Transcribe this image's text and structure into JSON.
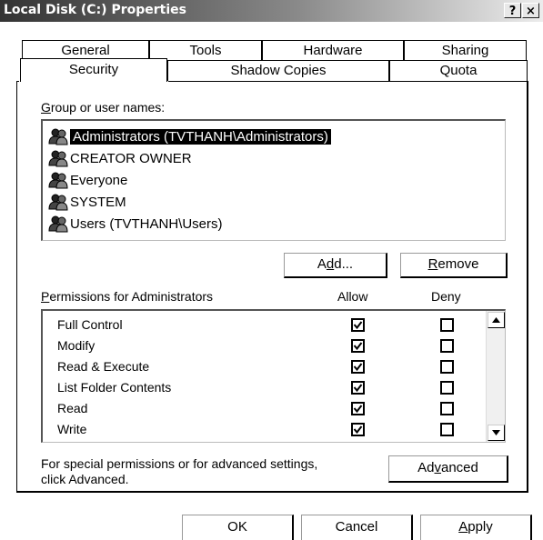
{
  "window": {
    "title": "Local Disk (C:) Properties",
    "help_button": "?",
    "close_button": "×"
  },
  "tabs": {
    "row_back": [
      "General",
      "Tools",
      "Hardware",
      "Sharing"
    ],
    "row_front": [
      "Security",
      "Shadow Copies",
      "Quota"
    ],
    "active": "Security"
  },
  "security": {
    "group_label": "Group or user names:",
    "users": [
      {
        "name": "Administrators (TVTHANH\\Administrators)",
        "selected": true
      },
      {
        "name": "CREATOR OWNER",
        "selected": false
      },
      {
        "name": "Everyone",
        "selected": false
      },
      {
        "name": "SYSTEM",
        "selected": false
      },
      {
        "name": "Users (TVTHANH\\Users)",
        "selected": false
      }
    ],
    "add_button": "Add...",
    "remove_button": "Remove",
    "permissions_label": "Permissions for Administrators",
    "allow_header": "Allow",
    "deny_header": "Deny",
    "permissions": [
      {
        "name": "Full Control",
        "allow": true,
        "deny": false
      },
      {
        "name": "Modify",
        "allow": true,
        "deny": false
      },
      {
        "name": "Read & Execute",
        "allow": true,
        "deny": false
      },
      {
        "name": "List Folder Contents",
        "allow": true,
        "deny": false
      },
      {
        "name": "Read",
        "allow": true,
        "deny": false
      },
      {
        "name": "Write",
        "allow": true,
        "deny": false
      }
    ],
    "advanced_note_line1": "For special permissions or for advanced settings,",
    "advanced_note_line2": "click Advanced.",
    "advanced_button": "Advanced"
  },
  "footer": {
    "ok_button": "OK",
    "cancel_button": "Cancel",
    "apply_button": "Apply"
  },
  "colors": {
    "selection_bg": "#000000",
    "selection_fg": "#ffffff",
    "title_fg": "#ffffff"
  }
}
